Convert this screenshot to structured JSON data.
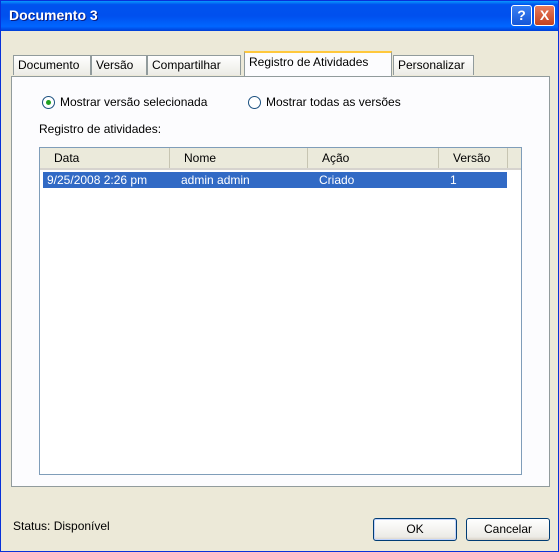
{
  "window": {
    "title": "Documento 3",
    "help_label": "?",
    "close_label": "X"
  },
  "tabs": [
    {
      "label": "Documento"
    },
    {
      "label": "Versão"
    },
    {
      "label": "Compartilhar"
    },
    {
      "label": "Registro de Atividades",
      "active": true
    },
    {
      "label": "Personalizar"
    }
  ],
  "options": {
    "selected_version": "Mostrar versão selecionada",
    "all_versions": "Mostrar todas as versões",
    "selected": "selected_version"
  },
  "log": {
    "label": "Registro de atividades:",
    "columns": [
      "Data",
      "Nome",
      "Ação",
      "Versão"
    ],
    "rows": [
      {
        "data": "9/25/2008 2:26 pm",
        "nome": "admin admin",
        "acao": "Criado",
        "versao": "1"
      }
    ]
  },
  "footer": {
    "status": "Status: Disponível",
    "ok_label": "OK",
    "cancel_label": "Cancelar"
  }
}
